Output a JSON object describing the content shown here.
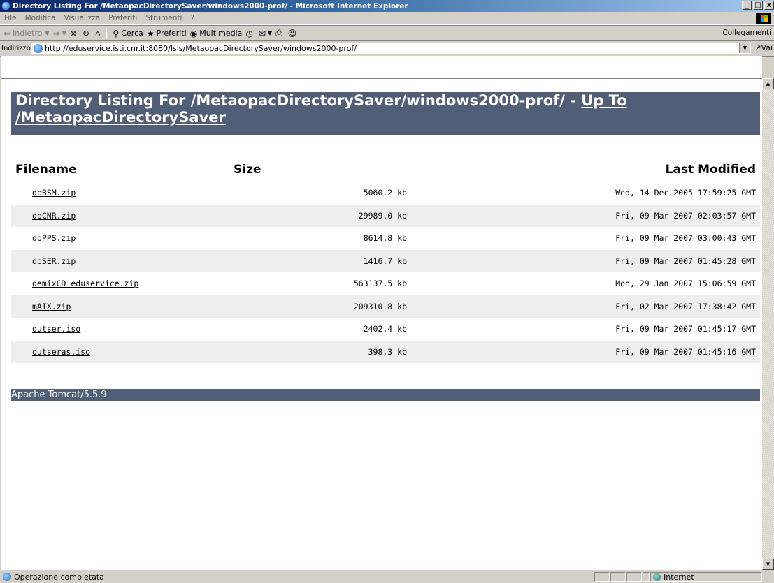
{
  "window": {
    "title": "Directory Listing For /MetaopacDirectorySaver/windows2000-prof/ - Microsoft Internet Explorer",
    "buttons": [
      "_",
      "á",
      "x"
    ]
  },
  "menu": [
    "File",
    "Modifica",
    "Visualizza",
    "Preferiti",
    "Strumenti",
    "?"
  ],
  "toolbar": {
    "back": "Indietro",
    "search": "Cerca",
    "favorites": "Preferiti",
    "media": "Multimedia",
    "links": "Collegamenti"
  },
  "address": {
    "label": "Indirizzo",
    "url": "http://eduservice.isti.cnr.it:8080/Isis/MetaopacDirectorySaver/windows2000-prof/",
    "go": "Vai"
  },
  "page": {
    "heading": "Directory Listing For /MetaopacDirectorySaver/windows2000-prof/ - ",
    "up_link": "Up To /MetaopacDirectorySaver",
    "columns": {
      "filename": "Filename",
      "size": "Size",
      "modified": "Last Modified"
    },
    "files": [
      {
        "name": "dbBSM.zip",
        "size": "5060.2 kb",
        "modified": "Wed, 14 Dec 2005 17:59:25 GMT"
      },
      {
        "name": "dbCNR.zip",
        "size": "29989.0 kb",
        "modified": "Fri, 09 Mar 2007 02:03:57 GMT"
      },
      {
        "name": "dbPPS.zip",
        "size": "8614.8 kb",
        "modified": "Fri, 09 Mar 2007 03:00:43 GMT"
      },
      {
        "name": "dbSER.zip",
        "size": "1416.7 kb",
        "modified": "Fri, 09 Mar 2007 01:45:28 GMT"
      },
      {
        "name": "demixCD_eduservice.zip",
        "size": "563137.5 kb",
        "modified": "Mon, 29 Jan 2007 15:06:59 GMT"
      },
      {
        "name": "mAIX.zip",
        "size": "209310.8 kb",
        "modified": "Fri, 02 Mar 2007 17:38:42 GMT"
      },
      {
        "name": "outser.iso",
        "size": "2402.4 kb",
        "modified": "Fri, 09 Mar 2007 01:45:17 GMT"
      },
      {
        "name": "outseras.iso",
        "size": "398.3 kb",
        "modified": "Fri, 09 Mar 2007 01:45:16 GMT"
      }
    ],
    "footer": "Apache Tomcat/5.5.9"
  },
  "status": {
    "text": "Operazione completata",
    "zone": "Internet"
  },
  "colors": {
    "header_bg": "#525d76",
    "row_alt": "#eeeeee"
  }
}
